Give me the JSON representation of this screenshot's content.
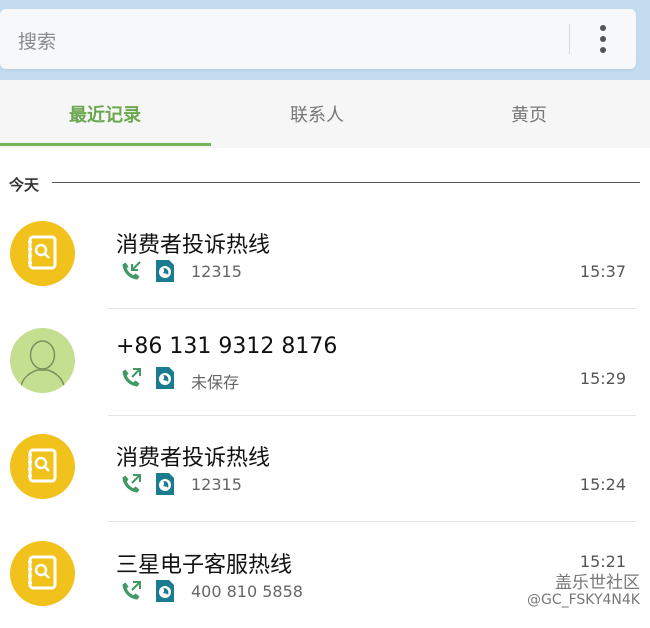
{
  "search": {
    "placeholder": "搜索",
    "more_icon": "more-vertical-icon"
  },
  "tabs": [
    {
      "label": "最近记录",
      "active": true
    },
    {
      "label": "联系人",
      "active": false
    },
    {
      "label": "黄页",
      "active": false
    }
  ],
  "section": {
    "label": "今天"
  },
  "calls": [
    {
      "name": "消费者投诉热线",
      "number": "12315",
      "time": "15:37",
      "direction": "incoming",
      "avatar": "yellow-pages-icon"
    },
    {
      "name": "+86 131 9312 8176",
      "number": "未保存",
      "time": "15:29",
      "direction": "outgoing",
      "avatar": "person-avatar-icon"
    },
    {
      "name": "消费者投诉热线",
      "number": "12315",
      "time": "15:24",
      "direction": "outgoing",
      "avatar": "yellow-pages-icon"
    },
    {
      "name": "三星电子客服热线",
      "number": "400 810 5858",
      "time": "15:21",
      "direction": "outgoing",
      "avatar": "yellow-pages-icon"
    }
  ],
  "watermark": {
    "line1": "盖乐世社区",
    "line2": "@GC_FSKY4N4K"
  },
  "colors": {
    "accent": "#6aa84f",
    "topbar": "#c3dcef",
    "avatar_yellow": "#f1c21b",
    "avatar_green": "#c3df8f",
    "call_icon": "#3f9a63",
    "sim_icon": "#1c7c8f"
  }
}
